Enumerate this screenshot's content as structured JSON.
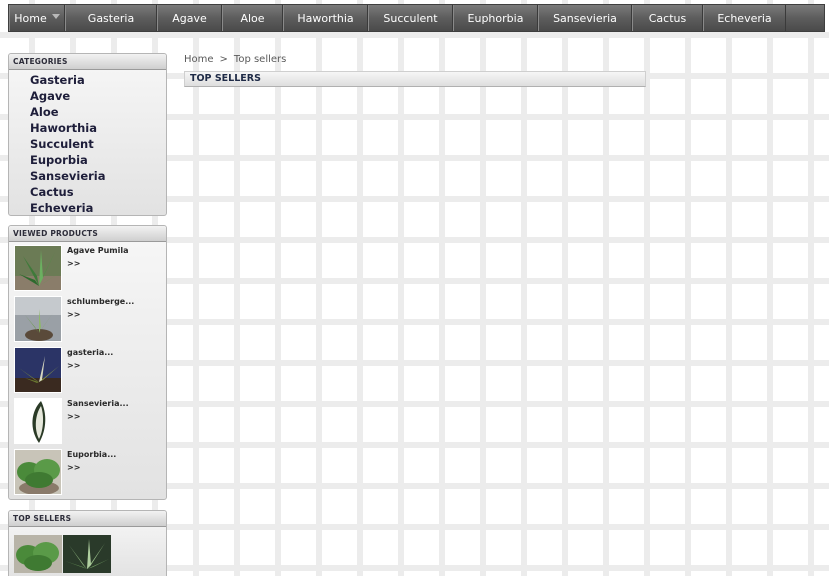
{
  "nav": {
    "items": [
      {
        "label": "Home",
        "has_dropdown": true
      },
      {
        "label": "Gasteria"
      },
      {
        "label": "Agave"
      },
      {
        "label": "Aloe"
      },
      {
        "label": "Haworthia"
      },
      {
        "label": "Succulent"
      },
      {
        "label": "Euphorbia"
      },
      {
        "label": "Sansevieria"
      },
      {
        "label": "Cactus"
      },
      {
        "label": "Echeveria"
      }
    ]
  },
  "sidebar": {
    "categories": {
      "title": "CATEGORIES",
      "items": [
        "Gasteria",
        "Agave",
        "Aloe",
        "Haworthia",
        "Succulent",
        "Euporbia",
        "Sansevieria",
        "Cactus",
        "Echeveria"
      ]
    },
    "viewed": {
      "title": "VIEWED PRODUCTS",
      "items": [
        {
          "name": "Agave Pumila",
          "more": ">>",
          "icon": "agave-photo"
        },
        {
          "name": "schlumberge...",
          "more": ">>",
          "icon": "schlumbergera-photo"
        },
        {
          "name": "gasteria...",
          "more": ">>",
          "icon": "gasteria-photo"
        },
        {
          "name": "Sansevieria...",
          "more": ">>",
          "icon": "sansevieria-photo"
        },
        {
          "name": "Euporbia...",
          "more": ">>",
          "icon": "euphorbia-photo"
        }
      ]
    },
    "top_sellers": {
      "title": "TOP SELLERS"
    }
  },
  "main": {
    "breadcrumb": {
      "home": "Home",
      "separator": ">",
      "current": "Top sellers"
    },
    "section_title": "TOP SELLERS"
  },
  "colors": {
    "nav_bg": "#5d5d5d",
    "category_text": "#1e1e3a",
    "section_title_text": "#1e2a46"
  }
}
